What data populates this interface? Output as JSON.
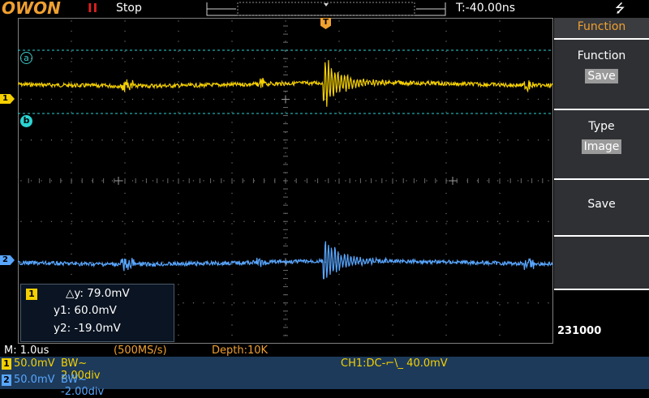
{
  "header": {
    "logo": "OWON",
    "run_icon": "pause-icon",
    "run_symbol": "II",
    "status": "Stop",
    "trigger_time": "T:-40.00ns",
    "usb_icon": "usb-icon",
    "usb_symbol": "⭍"
  },
  "screen": {
    "ch1_marker": "1",
    "ch2_marker": "2",
    "cursor_a": "a",
    "cursor_b": "b",
    "trigger_marker": "T"
  },
  "measurement": {
    "channel": "1",
    "dy": "△y: 79.0mV",
    "y1": "y1: 60.0mV",
    "y2": "y2: -19.0mV"
  },
  "menu": {
    "title": "Function",
    "items": [
      {
        "label": "Function",
        "value": "Save"
      },
      {
        "label": "Type",
        "value": "Image"
      },
      {
        "label": "Save",
        "value": ""
      },
      {
        "label": "",
        "value": ""
      }
    ],
    "footer": "231000"
  },
  "bottom": {
    "timebase": "M: 1.0us",
    "sample_rate": "(500MS/s)",
    "depth": "Depth:10K",
    "ch1": {
      "badge": "1",
      "scale": "50.0mV",
      "bw": "BW~ 2.00div"
    },
    "ch2": {
      "badge": "2",
      "scale": "50.0mV",
      "bw": "BW~ -2.00div"
    },
    "trigger": "CH1:DC-⌐\\_ 40.0mV"
  },
  "colors": {
    "ch1": "#f5d000",
    "ch2": "#58a6ff",
    "cursor": "#2bd4d4",
    "accent": "#f0a030"
  }
}
